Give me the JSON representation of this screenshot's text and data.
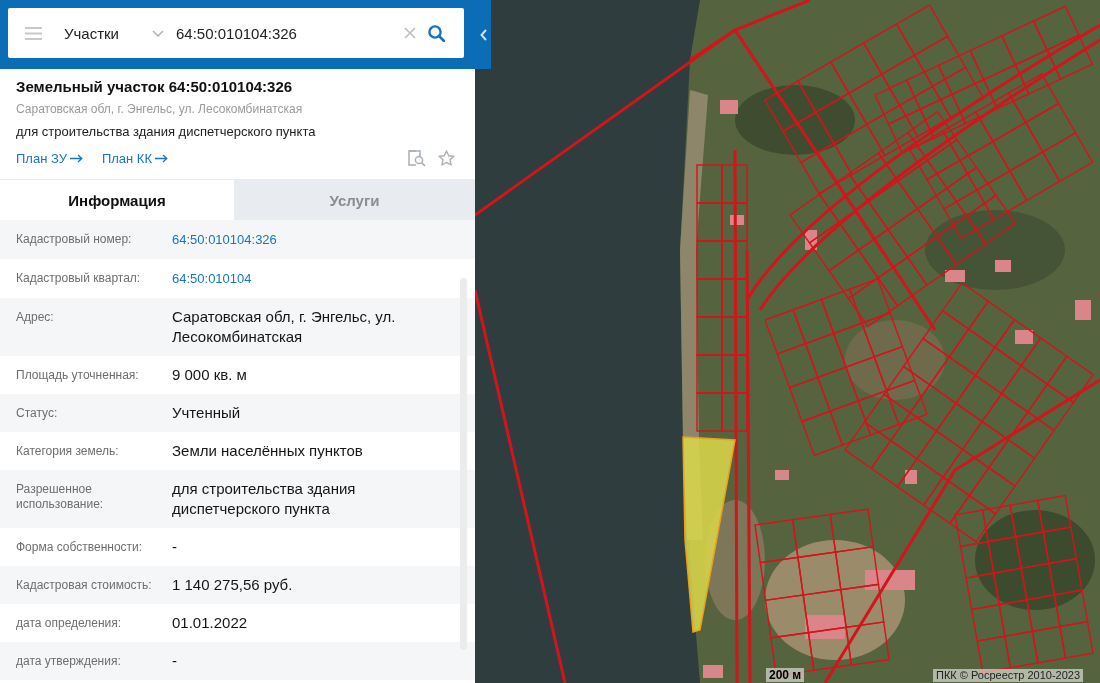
{
  "search": {
    "layer": "Участки",
    "query": "64:50:010104:326"
  },
  "card": {
    "title": "Земельный участок 64:50:010104:326",
    "address": "Саратовская обл, г. Энгельс, ул. Лесокомбинатская",
    "purpose": "для строительства здания диспетчерского пункта",
    "links": [
      "План ЗУ",
      "План КК"
    ]
  },
  "tabs": [
    {
      "label": "Информация",
      "selected": true
    },
    {
      "label": "Услуги",
      "selected": false
    }
  ],
  "info_rows": [
    {
      "label": "Кадастровый номер:",
      "value": "64:50:010104:326",
      "kind": "link"
    },
    {
      "label": "Кадастровый квартал:",
      "value": "64:50:010104",
      "kind": "link"
    },
    {
      "label": "Адрес:",
      "value": "Саратовская обл, г. Энгельс, ул. Лесокомбинатская",
      "kind": "text"
    },
    {
      "label": "Площадь уточненная:",
      "value": "9 000 кв. м",
      "kind": "text"
    },
    {
      "label": "Статус:",
      "value": "Учтенный",
      "kind": "text"
    },
    {
      "label": "Категория земель:",
      "value": "Земли населённых пунктов",
      "kind": "text"
    },
    {
      "label": "Разрешенное использование:",
      "value": "для строительства здания диспетчерского пункта",
      "kind": "text"
    },
    {
      "label": "Форма собственности:",
      "value": "-",
      "kind": "text"
    },
    {
      "label": "Кадастровая стоимость:",
      "value": "1 140 275,56 руб.",
      "kind": "text"
    },
    {
      "label": "дата определения:",
      "value": "01.01.2022",
      "kind": "text"
    },
    {
      "label": "дата утверждения:",
      "value": "-",
      "kind": "text"
    }
  ],
  "map": {
    "scale": "200 м",
    "attribution": "ПКК © Росреестр 2010-2023"
  }
}
